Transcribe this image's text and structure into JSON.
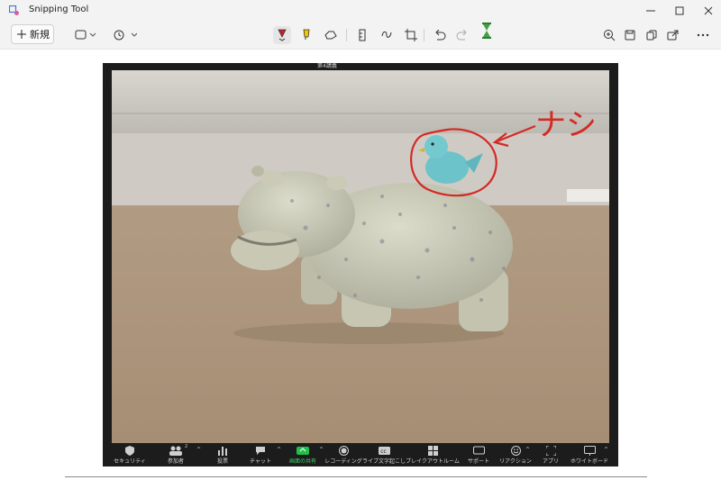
{
  "titlebar": {
    "app_title": "Snipping Tool",
    "minimize_icon": "minimize-icon",
    "maximize_icon": "maximize-icon",
    "close_icon": "close-icon"
  },
  "toolbar": {
    "new_label": "新規",
    "left_tools": [
      "snip-mode-icon",
      "delay-timer-icon"
    ],
    "center_tools": [
      "ballpoint-pen-icon",
      "highlighter-icon",
      "eraser-icon",
      "ruler-icon",
      "touch-writing-icon",
      "crop-icon",
      "undo-icon",
      "redo-icon",
      "hourglass-icon"
    ],
    "right_tools": [
      "zoom-icon",
      "save-icon",
      "copy-icon",
      "share-icon",
      "more-icon"
    ],
    "ink_color": "#c8202a",
    "highlighter_color": "#f2c600"
  },
  "screenshot": {
    "top_caption": "第4講義",
    "annotation_text": "ナシ",
    "annotation_color": "#d42a24",
    "meeting_toolbar": [
      {
        "label": "セキュリティ",
        "icon": "security-icon"
      },
      {
        "label": "参加者",
        "icon": "participants-icon",
        "count": "2"
      },
      {
        "label": "投票",
        "icon": "polls-icon"
      },
      {
        "label": "チャット",
        "icon": "chat-icon"
      },
      {
        "label": "画面の共有",
        "icon": "share-screen-icon"
      },
      {
        "label": "レコーディング",
        "icon": "record-icon"
      },
      {
        "label": "ライブ文字起こし",
        "icon": "captions-icon"
      },
      {
        "label": "ブレイクアウトルーム",
        "icon": "breakout-rooms-icon"
      },
      {
        "label": "サポート",
        "icon": "support-icon"
      },
      {
        "label": "リアクション",
        "icon": "reactions-icon"
      },
      {
        "label": "アプリ",
        "icon": "apps-icon"
      },
      {
        "label": "ホワイトボード",
        "icon": "whiteboard-icon"
      }
    ],
    "share_color": "#1fbf4a"
  }
}
